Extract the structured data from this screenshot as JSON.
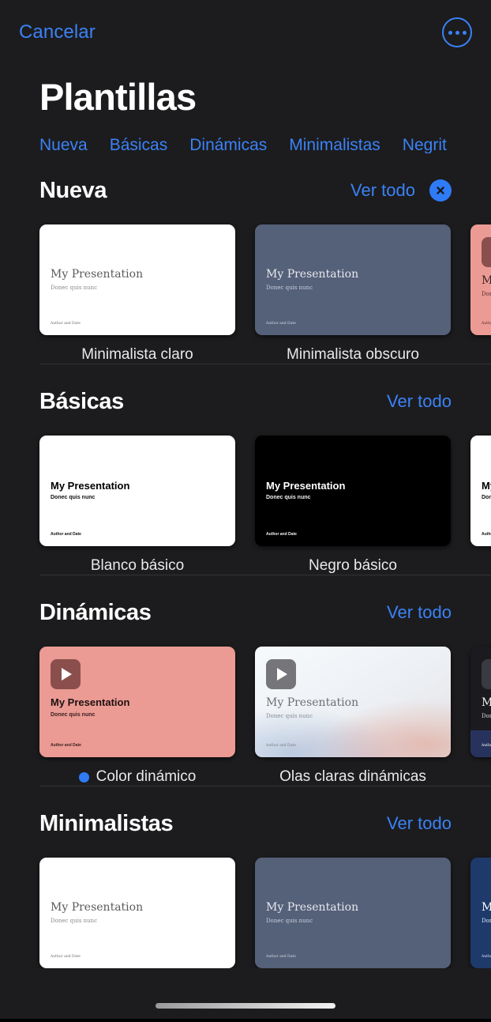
{
  "topbar": {
    "cancel_label": "Cancelar",
    "more_icon": "ellipsis-circle-icon"
  },
  "page_title": "Plantillas",
  "accent_color": "#3b82f6",
  "background_color": "#1c1c1e",
  "tabs": [
    {
      "label": "Nueva"
    },
    {
      "label": "Básicas"
    },
    {
      "label": "Dinámicas"
    },
    {
      "label": "Minimalistas"
    },
    {
      "label": "Negrit"
    }
  ],
  "see_all_label": "Ver todo",
  "thumb_text": {
    "title": "My Presentation",
    "subtitle": "Donec quis nunc",
    "footer": "Author and Date"
  },
  "sections": [
    {
      "title": "Nueva",
      "see_all": "Ver todo",
      "has_close": true,
      "close_icon": "close-circle-icon",
      "cards": [
        {
          "label": "Minimalista claro",
          "bg": "#ffffff",
          "text": "#5b5b5b",
          "sub": "#8a8a8a",
          "foot": "#6d6d6d",
          "serif": true,
          "play": false
        },
        {
          "label": "Minimalista obscuro",
          "bg": "#556079",
          "text": "#e6e9ef",
          "sub": "#c8cedb",
          "foot": "#d2d7e1",
          "serif": true,
          "play": false
        },
        {
          "label": "",
          "bg": "#ec9a94",
          "text": "#3a2322",
          "sub": "#55302e",
          "foot": "#55302e",
          "serif": true,
          "play": true,
          "play_bg": "#8a4f4c",
          "partial": true
        }
      ]
    },
    {
      "title": "Básicas",
      "see_all": "Ver todo",
      "has_close": false,
      "cards": [
        {
          "label": "Blanco básico",
          "bg": "#ffffff",
          "text": "#000000",
          "sub": "#111111",
          "foot": "#111111",
          "serif": false,
          "play": false
        },
        {
          "label": "Negro básico",
          "bg": "#000000",
          "text": "#ffffff",
          "sub": "#f0f0f0",
          "foot": "#f0f0f0",
          "serif": false,
          "play": false
        },
        {
          "label": "",
          "bg": "#ffffff",
          "text": "#000000",
          "sub": "#111111",
          "foot": "#111111",
          "serif": false,
          "play": false,
          "partial": true
        }
      ]
    },
    {
      "title": "Dinámicas",
      "see_all": "Ver todo",
      "has_close": false,
      "cards": [
        {
          "label": "Color dinámico",
          "bg": "#ec9a94",
          "text": "#1d1210",
          "sub": "#3a2320",
          "foot": "#3a2320",
          "serif": false,
          "play": true,
          "play_bg": "#8a4f4c",
          "selected": true
        },
        {
          "label": "Olas claras dinámicas",
          "bg": "gradient-waves",
          "text": "#6e6e74",
          "sub": "#8b8b92",
          "foot": "#7a7a80",
          "serif": true,
          "play": true,
          "play_bg": "#76767a"
        },
        {
          "label": "",
          "bg": "#1a1a1f",
          "text": "#f2f2f2",
          "sub": "#d8d8dc",
          "foot": "#ffffff",
          "serif": true,
          "play": true,
          "play_bg": "#3a3a42",
          "partial": true,
          "navy_footer": true
        }
      ]
    },
    {
      "title": "Minimalistas",
      "see_all": "Ver todo",
      "has_close": false,
      "cards": [
        {
          "label": "",
          "bg": "#ffffff",
          "text": "#5b5b5b",
          "sub": "#8a8a8a",
          "foot": "#6d6d6d",
          "serif": true,
          "play": false,
          "clipped": true
        },
        {
          "label": "",
          "bg": "#556079",
          "text": "#e6e9ef",
          "sub": "#c8cedb",
          "foot": "#d2d7e1",
          "serif": true,
          "play": false,
          "clipped": true
        },
        {
          "label": "",
          "bg": "#1d3a6b",
          "text": "#ffffff",
          "sub": "#dce6f5",
          "foot": "#dce6f5",
          "serif": true,
          "play": false,
          "clipped": true,
          "partial": true
        }
      ]
    }
  ],
  "home_indicator": "home-indicator-bar"
}
